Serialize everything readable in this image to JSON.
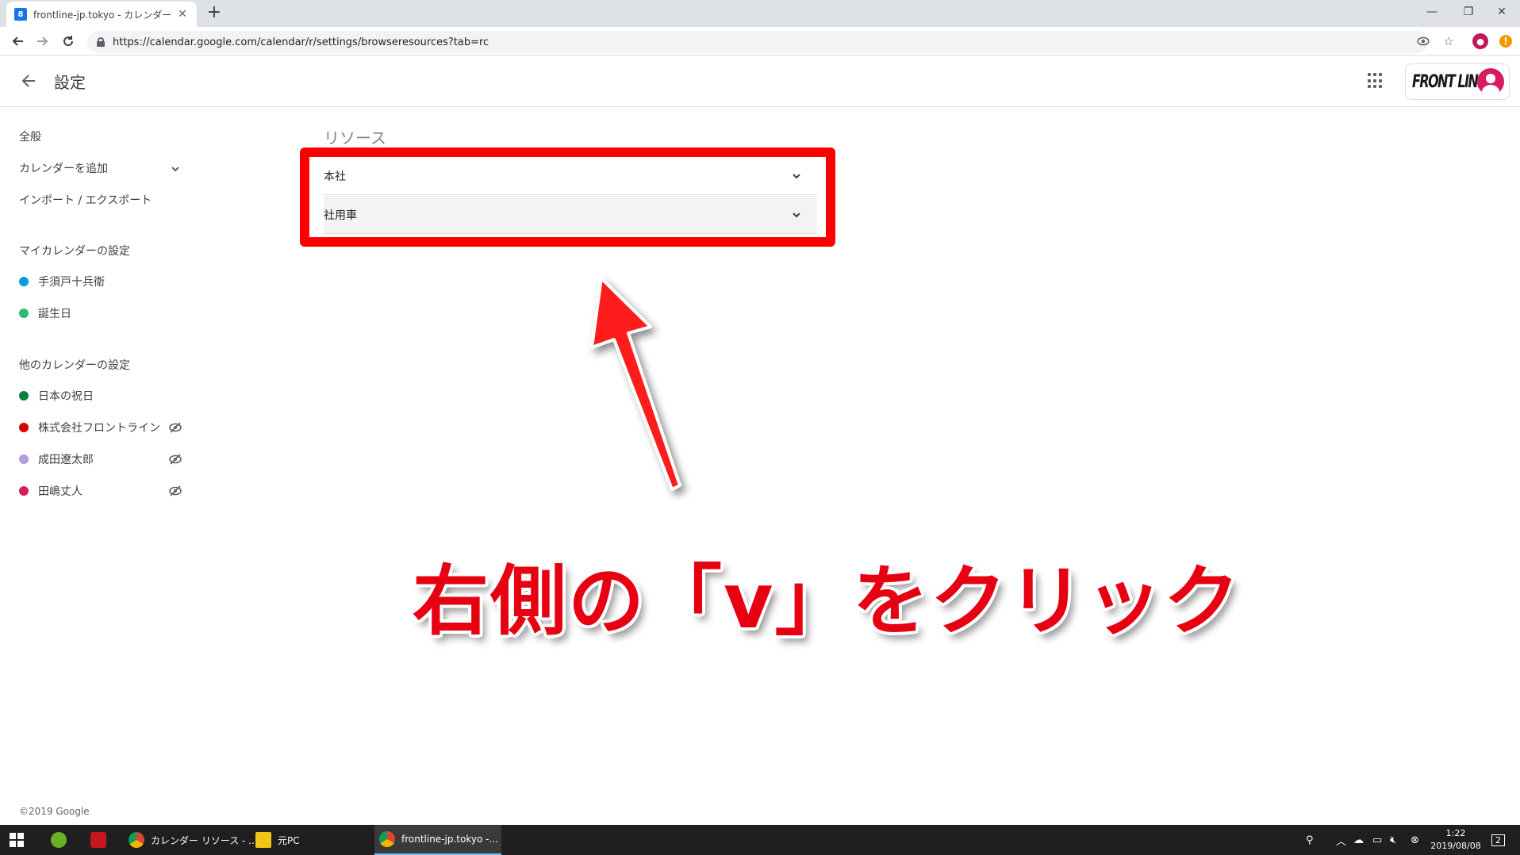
{
  "browser": {
    "tab_title": "frontline-jp.tokyo - カレンダー - リソ",
    "tab_favicon": "8",
    "new_tab_label": "+",
    "url": "https://calendar.google.com/calendar/r/settings/browseresources?tab=rc"
  },
  "header": {
    "title": "設定",
    "logo_text": "FRONT LINE"
  },
  "sidebar": {
    "general": "全般",
    "add_calendar": "カレンダーを追加",
    "import_export": "インポート / エクスポート",
    "my_calendars_heading": "マイカレンダーの設定",
    "my_calendars": [
      {
        "name": "手須戸十兵衛",
        "color": "#039be5"
      },
      {
        "name": "誕生日",
        "color": "#33b679"
      }
    ],
    "other_calendars_heading": "他のカレンダーの設定",
    "other_calendars": [
      {
        "name": "日本の祝日",
        "color": "#0b8043",
        "hidden": false
      },
      {
        "name": "株式会社フロントライン",
        "color": "#d50000",
        "hidden": true
      },
      {
        "name": "成田遼太郎",
        "color": "#b39ddb",
        "hidden": true
      },
      {
        "name": "田嶋丈人",
        "color": "#d81b60",
        "hidden": true
      }
    ]
  },
  "main": {
    "section_title": "リソース",
    "resources": [
      {
        "label": "本社"
      },
      {
        "label": "社用車"
      }
    ],
    "instruction": "右側の「v」をクリック",
    "highlight_color": "#ff0000"
  },
  "footer": {
    "copyright": "©2019 Google"
  },
  "taskbar": {
    "apps": [
      {
        "label": "カレンダー リソース - ..."
      },
      {
        "label": "元PC"
      },
      {
        "label": "frontline-jp.tokyo -..."
      }
    ],
    "time": "1:22",
    "date": "2019/08/08",
    "notification_count": "2"
  }
}
